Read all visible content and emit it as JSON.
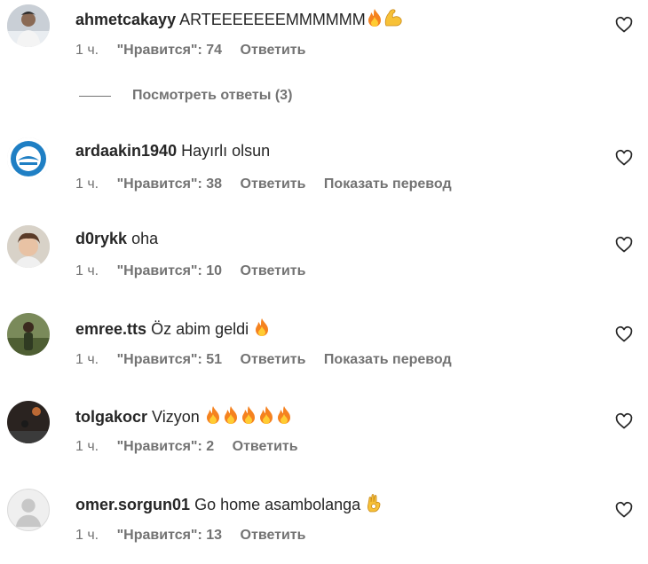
{
  "comments": [
    {
      "username": "ahmetcakayy",
      "text": "ARTEEEEEEEMMMMMM",
      "emoji": [
        "fire",
        "flexed-biceps"
      ],
      "time": "1 ч.",
      "likes": "\"Нравится\": 74",
      "reply": "Ответить",
      "translate": "",
      "avatar": "photo-man-shirt"
    },
    {
      "username": "ardaakin1940",
      "text": "Hayırlı olsun",
      "emoji": [],
      "time": "1 ч.",
      "likes": "\"Нравится\": 38",
      "reply": "Ответить",
      "translate": "Показать перевод",
      "avatar": "adana-demirspor-logo"
    },
    {
      "username": "d0rykk",
      "text": "oha",
      "emoji": [],
      "time": "1 ч.",
      "likes": "\"Нравится\": 10",
      "reply": "Ответить",
      "translate": "",
      "avatar": "photo-child"
    },
    {
      "username": "emree.tts",
      "text": "Öz abim geldi",
      "emoji": [
        "fire"
      ],
      "time": "1 ч.",
      "likes": "\"Нравится\": 51",
      "reply": "Ответить",
      "translate": "Показать перевод",
      "avatar": "photo-outdoor"
    },
    {
      "username": "tolgakocr",
      "text": "Vizyon",
      "emoji": [
        "fire",
        "fire",
        "fire",
        "fire",
        "fire"
      ],
      "time": "1 ч.",
      "likes": "\"Нравится\": 2",
      "reply": "Ответить",
      "translate": "",
      "avatar": "photo-night"
    },
    {
      "username": "omer.sorgun01",
      "text": "Go home asambolanga",
      "emoji": [
        "ok-hand"
      ],
      "time": "1 ч.",
      "likes": "\"Нравится\": 13",
      "reply": "Ответить",
      "translate": "",
      "avatar": "default-avatar"
    }
  ],
  "replies_link": "Посмотреть ответы (3)",
  "icons": {
    "like": "heart-outline-icon"
  },
  "colors": {
    "text": "#262626",
    "secondary": "#737373"
  }
}
